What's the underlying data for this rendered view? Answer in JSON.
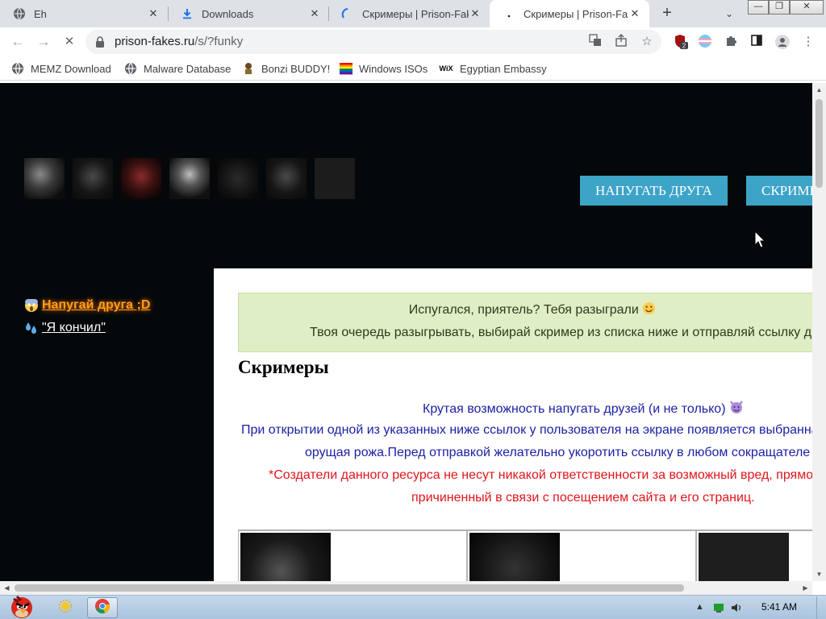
{
  "browser": {
    "tabs": [
      {
        "title": "Eh",
        "icon": "globe-icon",
        "active": false
      },
      {
        "title": "Downloads",
        "icon": "download-icon",
        "active": false
      },
      {
        "title": "Скримеры | Prison-Fakes",
        "icon": "loading-spinner-icon",
        "active": false
      },
      {
        "title": "Скримеры | Prison-Fakes",
        "icon": "dot-icon",
        "active": true
      }
    ],
    "new_tab_label": "+",
    "tab_menu_label": "⌄",
    "window_controls": {
      "minimize": "—",
      "maximize": "❐",
      "close": "✕"
    },
    "nav": {
      "back": "←",
      "forward": "→",
      "reload": "✕"
    },
    "address": {
      "host": "prison-fakes.ru",
      "path": "/s/?funky"
    },
    "extension_badge": "2",
    "bookmarks": [
      {
        "label": "MEMZ Download",
        "icon": "globe-icon"
      },
      {
        "label": "Malware Database",
        "icon": "globe-icon"
      },
      {
        "label": "Bonzi BUDDY!",
        "icon": "bonzi-icon"
      },
      {
        "label": "Windows ISOs",
        "icon": "rainbow-flag-icon"
      },
      {
        "label": "Egyptian Embassy",
        "icon": "wix-icon",
        "icon_text": "WiX"
      }
    ]
  },
  "page": {
    "top_buttons": [
      "НАПУГАТЬ ДРУГА",
      "СКРИМЕРЫ"
    ],
    "side_links": [
      {
        "label": " Напугай друга ;D",
        "emoji": "scream-emoji"
      },
      {
        "label": "\"Я кончил\"",
        "emoji": "sweat-droplets-emoji"
      }
    ],
    "alert": {
      "line1": "Испугался, приятель? Тебя разыграли",
      "line2": "Твоя очередь разыгрывать, выбирай скример из списка ниже и отправляй ссылку другу"
    },
    "heading": "Скримеры",
    "description": {
      "line1": "Крутая возможность напугать друзей (и не только)",
      "line2": "При открытии одной из указанных ниже ссылок у пользователя на экране появляется выбранная",
      "line3": "орущая рожа.Перед отправкой желательно укоротить ссылку в любом сокращателе",
      "disclaimer1": "*Создатели данного ресурса не несут никакой ответственности за возможный вред, прямой",
      "disclaimer2": "причиненный в связи с посещением сайта и его страниц."
    }
  },
  "taskbar": {
    "clock": "5:41 AM"
  },
  "colors": {
    "page_bg": "#05080a",
    "button_bg": "#3da4c8",
    "alert_bg": "#dfeec4",
    "link_orange": "#ff9e1a",
    "text_blue": "#1c21a5",
    "text_red": "#e0151b"
  }
}
